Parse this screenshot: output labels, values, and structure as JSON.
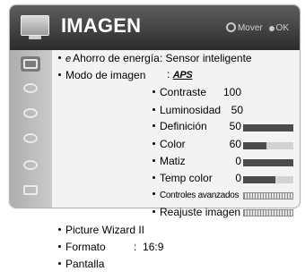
{
  "header": {
    "title": "IMAGEN",
    "move_hint": "Mover",
    "ok_hint": "OK",
    "icon": "tv-picture-icon"
  },
  "sidebar": {
    "items": [
      {
        "icon": "picture-menu-icon",
        "active": true
      },
      {
        "icon": "audio-menu-icon"
      },
      {
        "icon": "setup-menu-icon"
      },
      {
        "icon": "time-menu-icon"
      },
      {
        "icon": "lock-menu-icon"
      },
      {
        "icon": "option-menu-icon"
      }
    ]
  },
  "menu": {
    "energy_prefix": "e",
    "energy_label": "Ahorro de energía: Sensor inteligente",
    "mode_label": "Modo de imagen",
    "mode_colon": ":",
    "mode_value": "APS",
    "settings": [
      {
        "label": "Contraste",
        "value": "100"
      },
      {
        "label": "Luminosidad",
        "value": "50"
      },
      {
        "label": "Definición",
        "value": "50",
        "level": 1.0
      },
      {
        "label": "Color",
        "value": "60",
        "level": 0.47
      },
      {
        "label": "Matiz",
        "value": "0",
        "level": 1.0
      },
      {
        "label": "Temp color",
        "value": "0",
        "level": 0.65
      }
    ],
    "advanced_label": "Controles avanzados",
    "reset_label": "Reajuste imagen",
    "wizard_label": "Picture Wizard II",
    "format_label": "Formato",
    "format_colon": ":",
    "format_value": "16:9",
    "screen_label": "Pantalla"
  },
  "colors": {
    "titlebar": "#3a3a3a",
    "bar_fill": "#4c4c4c",
    "bar_track": "#d2d2d2"
  }
}
